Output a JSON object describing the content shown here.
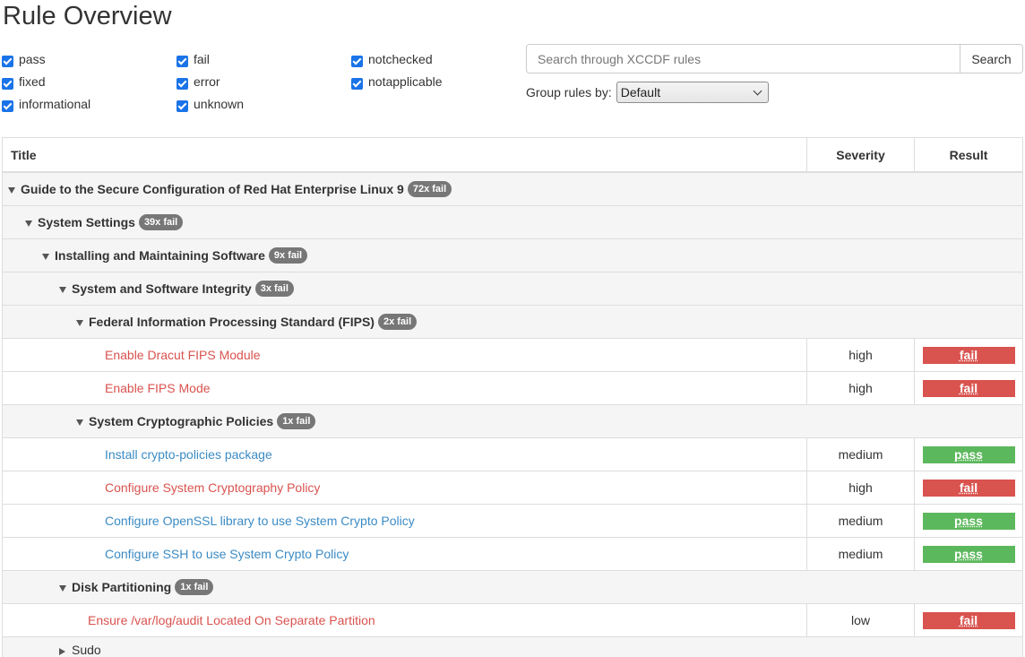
{
  "page_title": "Rule Overview",
  "filters": [
    {
      "label": "pass",
      "checked": true
    },
    {
      "label": "fixed",
      "checked": true
    },
    {
      "label": "informational",
      "checked": true
    },
    {
      "label": "fail",
      "checked": true
    },
    {
      "label": "error",
      "checked": true
    },
    {
      "label": "unknown",
      "checked": true
    },
    {
      "label": "notchecked",
      "checked": true
    },
    {
      "label": "notapplicable",
      "checked": true
    }
  ],
  "search": {
    "placeholder": "Search through XCCDF rules",
    "button_label": "Search"
  },
  "group_by": {
    "label": "Group rules by:",
    "selected": "Default"
  },
  "table": {
    "headers": {
      "title": "Title",
      "severity": "Severity",
      "result": "Result"
    },
    "groups": [
      {
        "title": "Guide to the Secure Configuration of Red Hat Enterprise Linux 9",
        "badge": "72x fail"
      },
      {
        "title": "System Settings",
        "badge": "39x fail"
      },
      {
        "title": "Installing and Maintaining Software",
        "badge": "9x fail"
      },
      {
        "title": "System and Software Integrity",
        "badge": "3x fail"
      },
      {
        "title": "Federal Information Processing Standard (FIPS)",
        "badge": "2x fail"
      },
      {
        "title": "System Cryptographic Policies",
        "badge": "1x fail"
      },
      {
        "title": "Disk Partitioning",
        "badge": "1x fail"
      },
      {
        "title": "Sudo",
        "badge": ""
      }
    ],
    "rules": [
      {
        "title": "Enable Dracut FIPS Module",
        "severity": "high",
        "result": "fail"
      },
      {
        "title": "Enable FIPS Mode",
        "severity": "high",
        "result": "fail"
      },
      {
        "title": "Install crypto-policies package",
        "severity": "medium",
        "result": "pass"
      },
      {
        "title": "Configure System Cryptography Policy",
        "severity": "high",
        "result": "fail"
      },
      {
        "title": "Configure OpenSSL library to use System Crypto Policy",
        "severity": "medium",
        "result": "pass"
      },
      {
        "title": "Configure SSH to use System Crypto Policy",
        "severity": "medium",
        "result": "pass"
      },
      {
        "title": "Ensure /var/log/audit Located On Separate Partition",
        "severity": "low",
        "result": "fail"
      }
    ]
  },
  "colors": {
    "fail": "#d9534f",
    "pass": "#5cb85c",
    "pass_link": "#3b8bc4",
    "badge": "#777777",
    "checkbox": "#1a73e8"
  }
}
